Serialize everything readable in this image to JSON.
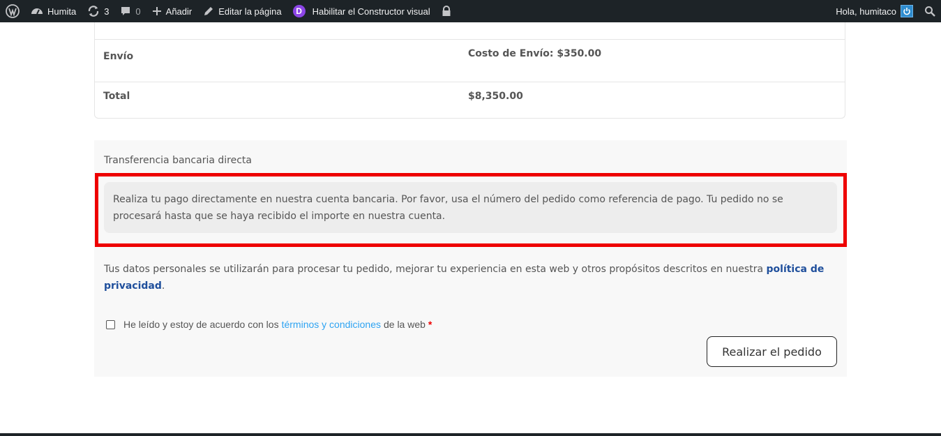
{
  "adminbar": {
    "site_name": "Humita",
    "updates_count": "3",
    "comments_count": "0",
    "add_new": "Añadir",
    "edit_page": "Editar la página",
    "divi_letter": "D",
    "visual_builder": "Habilitar el Constructor visual",
    "greeting": "Hola, humitaco"
  },
  "order": {
    "rows": [
      {
        "label": "Envío",
        "value": "Costo de Envío: $350.00"
      },
      {
        "label": "Total",
        "value": "$8,350.00"
      }
    ]
  },
  "payment": {
    "method_label": "Transferencia bancaria directa",
    "description": "Realiza tu pago directamente en nuestra cuenta bancaria. Por favor, usa el número del pedido como referencia de pago. Tu pedido no se procesará hasta que se haya recibido el importe en nuestra cuenta.",
    "privacy_text": "Tus datos personales se utilizarán para procesar tu pedido, mejorar tu experiencia en esta web y otros propósitos descritos en nuestra",
    "privacy_link": "política de privacidad",
    "privacy_end": ".",
    "terms_prefix": "He leído y estoy de acuerdo con los",
    "terms_link": "términos y condiciones",
    "terms_suffix": "de la web",
    "required_mark": "*",
    "place_order": "Realizar el pedido"
  },
  "colors": {
    "adminbar_bg": "#1d2327",
    "highlight": "#ee0000",
    "link_blue": "#2ea3f2",
    "privacy_link": "#1f4f9c"
  }
}
